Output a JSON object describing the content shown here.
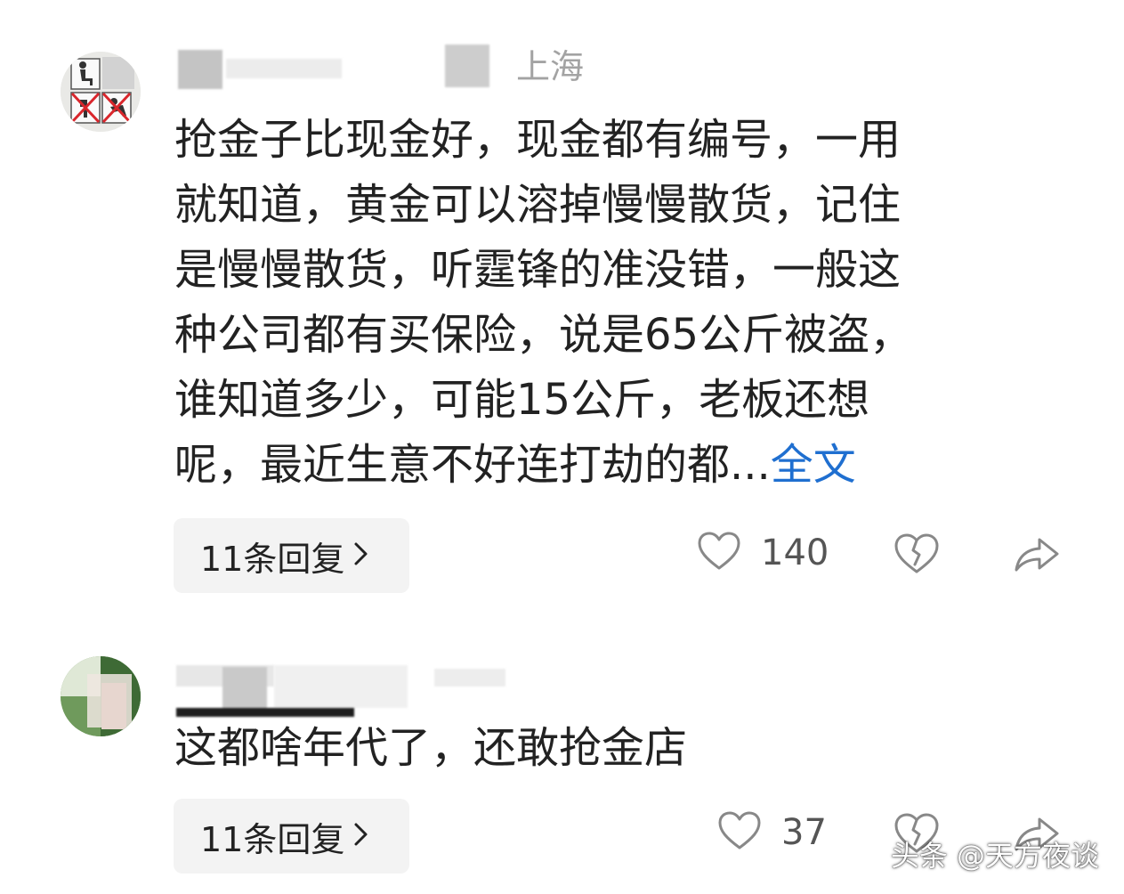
{
  "comments": [
    {
      "location": "上海",
      "lines": [
        "抢金子比现金好，现金都有编号，一用",
        "就知道，黄金可以溶掉慢慢散货，记住",
        "是慢慢散货，听霆锋的准没错，一般这",
        "种公司都有买保险，说是65公斤被盗，",
        "谁知道多少，可能15公斤，老板还想",
        "呢，最近生意不好连打劫的都..."
      ],
      "more_label": "全文",
      "replies_label": "11条回复",
      "likes": "140"
    },
    {
      "lines": [
        "这都啥年代了，还敢抢金店"
      ],
      "replies_label": "11条回复",
      "likes": "37"
    }
  ],
  "icons": {
    "like": "heart-outline-icon",
    "dislike": "broken-heart-icon",
    "share": "share-arrow-icon",
    "chevron": "chevron-right-icon"
  },
  "colors": {
    "text": "#222222",
    "meta": "#a3a3a3",
    "link": "#1f6fd0",
    "button_bg": "#f3f3f3"
  },
  "watermark": "头条 @天方夜谈"
}
